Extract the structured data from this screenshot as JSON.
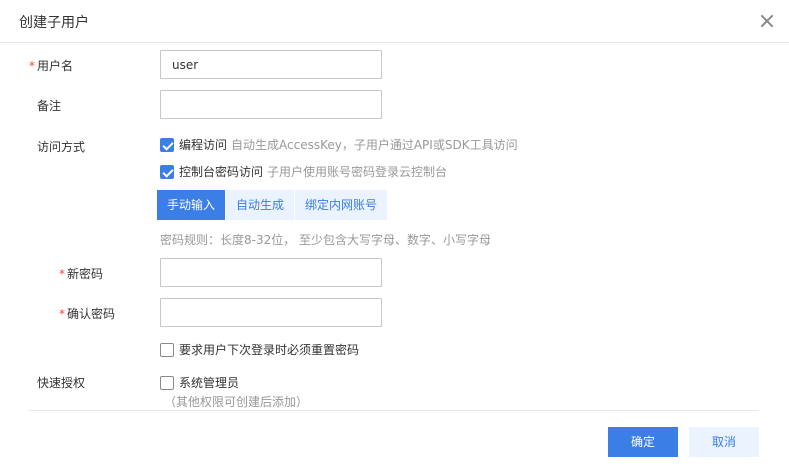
{
  "dialog": {
    "title": "创建子用户",
    "close_icon": "close-icon"
  },
  "form": {
    "username": {
      "required_mark": "*",
      "label": "用户名",
      "value": "user"
    },
    "remark": {
      "label": "备注",
      "value": ""
    },
    "access": {
      "label": "访问方式",
      "programmatic": {
        "checked": true,
        "label": "编程访问",
        "desc": "自动生成AccessKey，子用户通过API或SDK工具访问"
      },
      "console": {
        "checked": true,
        "label": "控制台密码访问",
        "desc": "子用户使用账号密码登录云控制台"
      }
    },
    "password_modes": [
      "手动输入",
      "自动生成",
      "绑定内网账号"
    ],
    "password_modes_active": 0,
    "password_rule": "密码规则：长度8-32位， 至少包含大写字母、数字、小写字母",
    "new_password": {
      "required_mark": "*",
      "label": "新密码",
      "value": ""
    },
    "confirm_password": {
      "required_mark": "*",
      "label": "确认密码",
      "value": ""
    },
    "reset_on_login": {
      "checked": false,
      "label": "要求用户下次登录时必须重置密码"
    },
    "quick_auth": {
      "label": "快速授权",
      "admin": {
        "checked": false,
        "label": "系统管理员"
      },
      "note": "（其他权限可创建后添加）"
    }
  },
  "footer": {
    "confirm_label": "确定",
    "cancel_label": "取消"
  },
  "colors": {
    "primary": "#3a7ee6",
    "required": "#e74c3c",
    "muted": "#999999"
  }
}
